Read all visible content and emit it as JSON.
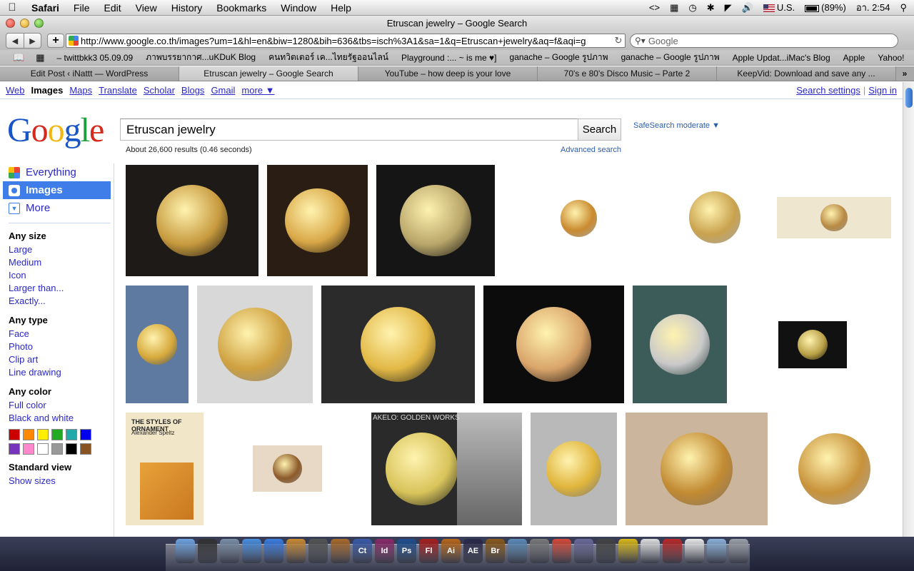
{
  "menubar": {
    "app_name": "Safari",
    "items": [
      "File",
      "Edit",
      "View",
      "History",
      "Bookmarks",
      "Window",
      "Help"
    ],
    "status_arrows": "<>",
    "input_source": "U.S.",
    "battery": "(89%)",
    "clock": "อา. 2:54"
  },
  "window": {
    "title": "Etruscan jewelry – Google Search"
  },
  "toolbar": {
    "url": "http://www.google.co.th/images?um=1&hl=en&biw=1280&bih=636&tbs=isch%3A1&sa=1&q=Etruscan+jewelry&aq=f&aqi=g",
    "search_placeholder": "Google"
  },
  "bookmarks": [
    "– twittbkk3 05.09.09",
    "ภาพบรรยากาศ...uKDuK Blog",
    "คนทวิตเตอร์ เค...ไทยรัฐออนไลน์",
    "Playground :... ~ is me ♥]",
    "ganache – Google รูปภาพ",
    "ganache – Google รูปภาพ",
    "Apple Updat...iMac's Blog",
    "Apple",
    "Yahoo!"
  ],
  "tabs": [
    {
      "label": "Edit Post ‹ iNattt — WordPress",
      "active": false
    },
    {
      "label": "Etruscan jewelry – Google Search",
      "active": true
    },
    {
      "label": "YouTube – how deep is your love",
      "active": false
    },
    {
      "label": "70's e 80's Disco Music – Parte 2",
      "active": false
    },
    {
      "label": "KeepVid: Download and save any ...",
      "active": false
    }
  ],
  "gbar": {
    "links": [
      "Web",
      "Images",
      "Maps",
      "Translate",
      "Scholar",
      "Blogs",
      "Gmail",
      "more ▼"
    ],
    "current": "Images",
    "search_settings": "Search settings",
    "separator": "|",
    "sign_in": "Sign in"
  },
  "search": {
    "query": "Etruscan jewelry",
    "button": "Search",
    "safesearch": "SafeSearch moderate ▼",
    "stats": "About 26,600 results (0.46 seconds)",
    "advanced": "Advanced search"
  },
  "logo": {
    "letters": [
      "G",
      "o",
      "o",
      "g",
      "l",
      "e"
    ]
  },
  "sidebar": {
    "modes": [
      {
        "label": "Everything",
        "icon": "everything-icon",
        "active": false
      },
      {
        "label": "Images",
        "icon": "images-icon",
        "active": true
      },
      {
        "label": "More",
        "icon": "more-icon",
        "active": false
      }
    ],
    "size": {
      "heading": "Any size",
      "options": [
        "Large",
        "Medium",
        "Icon",
        "Larger than...",
        "Exactly..."
      ]
    },
    "type": {
      "heading": "Any type",
      "options": [
        "Face",
        "Photo",
        "Clip art",
        "Line drawing"
      ]
    },
    "color": {
      "heading": "Any color",
      "options": [
        "Full color",
        "Black and white"
      ],
      "swatches": [
        "#cc0000",
        "#ff8800",
        "#ffee00",
        "#22aa22",
        "#22aaaa",
        "#0000ee",
        "#7733bb",
        "#ff88cc",
        "#ffffff",
        "#999999",
        "#000000",
        "#885522"
      ]
    },
    "view": {
      "heading": "Standard view",
      "options": [
        "Show sizes"
      ]
    }
  },
  "results": {
    "images": [
      {
        "name": "etruscan-jewelry-set-black-bg",
        "bg": "#1d1a17",
        "fg": "#c79a3e"
      },
      {
        "name": "etruscan-gold-collar",
        "bg": "#2a1e14",
        "fg": "#d9a847"
      },
      {
        "name": "etruscan-filigree-necklace",
        "bg": "#151515",
        "fg": "#b9a66a"
      },
      {
        "name": "etruscan-jewelry-white-bg",
        "bg": "#ffffff",
        "fg": "#c98a2f"
      },
      {
        "name": "etruscan-gold-disc-brooch",
        "bg": "#ffffff",
        "fg": "#c9a24e"
      },
      {
        "name": "etruscan-map-collage",
        "bg": "#efe6cf",
        "fg": "#b88a45"
      },
      {
        "name": "etruscan-gold-earring-blue",
        "bg": "#5e7aa0",
        "fg": "#d6a93b"
      },
      {
        "name": "etruscan-gold-ring-fragment",
        "bg": "#d8d8d8",
        "fg": "#cfa140"
      },
      {
        "name": "etruscan-gold-disc-necklace",
        "bg": "#2b2b2b",
        "fg": "#e2b845"
      },
      {
        "name": "etruscan-gold-studs-black",
        "bg": "#0c0c0c",
        "fg": "#d9a46a"
      },
      {
        "name": "etruscan-bead-collar-bust",
        "bg": "#3b5c58",
        "fg": "#c9c9c9"
      },
      {
        "name": "etruscan-gold-earrings",
        "bg": "#111111",
        "fg": "#b9a046"
      },
      {
        "name": "styles-of-ornament-book",
        "bg": "#f1e6c8",
        "fg": "#e29a34"
      },
      {
        "name": "etruscan-gold-fragment-small",
        "bg": "#e8d9c6",
        "fg": "#8c5a2a"
      },
      {
        "name": "akelo-golden-works-book",
        "bg": "#2a2a2a",
        "fg": "#d8c45a"
      },
      {
        "name": "etruscan-gold-round-brooch",
        "bg": "#b9b9b9",
        "fg": "#e0b53c"
      },
      {
        "name": "etruscan-gold-crown-museum",
        "bg": "#cbb59c",
        "fg": "#c28a32"
      },
      {
        "name": "etruscan-snake-bracelet",
        "bg": "#ffffff",
        "fg": "#c8923a"
      }
    ],
    "book_title": "THE STYLES OF ORNAMENT",
    "book_author": "Alexander Speltz",
    "akelo_title": "AKELO: GOLDEN WORKS"
  },
  "dock": {
    "apps": [
      {
        "name": "finder-icon",
        "label": "",
        "color": "#6ea3e0"
      },
      {
        "name": "dashboard-icon",
        "label": "",
        "color": "#333333"
      },
      {
        "name": "mail-icon",
        "label": "",
        "color": "#7a8ea6"
      },
      {
        "name": "safari-icon",
        "label": "",
        "color": "#4a8fe0"
      },
      {
        "name": "itunes-icon",
        "label": "",
        "color": "#3b7de0"
      },
      {
        "name": "iphoto-icon",
        "label": "",
        "color": "#c98a32"
      },
      {
        "name": "aperture-icon",
        "label": "",
        "color": "#555555"
      },
      {
        "name": "garageband-icon",
        "label": "",
        "color": "#a86a2a"
      },
      {
        "name": "contribute-icon",
        "label": "Ct",
        "color": "#3a5aa8"
      },
      {
        "name": "indesign-icon",
        "label": "Id",
        "color": "#8a2a6a"
      },
      {
        "name": "photoshop-icon",
        "label": "Ps",
        "color": "#1f4f8f"
      },
      {
        "name": "flash-icon",
        "label": "Fl",
        "color": "#a81f1f"
      },
      {
        "name": "illustrator-icon",
        "label": "Ai",
        "color": "#b8661a"
      },
      {
        "name": "after-effects-icon",
        "label": "AE",
        "color": "#2a2a4a"
      },
      {
        "name": "bridge-icon",
        "label": "Br",
        "color": "#8a5a1a"
      },
      {
        "name": "preview-icon",
        "label": "",
        "color": "#5a8ab8"
      },
      {
        "name": "system-prefs-icon",
        "label": "",
        "color": "#7a7a7a"
      },
      {
        "name": "chrome-icon",
        "label": "",
        "color": "#d44a3a"
      },
      {
        "name": "tool-icon",
        "label": "",
        "color": "#6a6a9a"
      },
      {
        "name": "camera-icon",
        "label": "",
        "color": "#444444"
      },
      {
        "name": "adium-icon",
        "label": "",
        "color": "#d8b81a"
      },
      {
        "name": "document-icon",
        "label": "",
        "color": "#dddddd"
      },
      {
        "name": "photo-booth-icon",
        "label": "",
        "color": "#b82a2a"
      },
      {
        "name": "textedit-icon",
        "label": "",
        "color": "#e8e8e8"
      },
      {
        "name": "applications-folder-icon",
        "label": "",
        "color": "#8ab0d8"
      },
      {
        "name": "trash-icon",
        "label": "",
        "color": "#9aa0a8"
      }
    ]
  }
}
